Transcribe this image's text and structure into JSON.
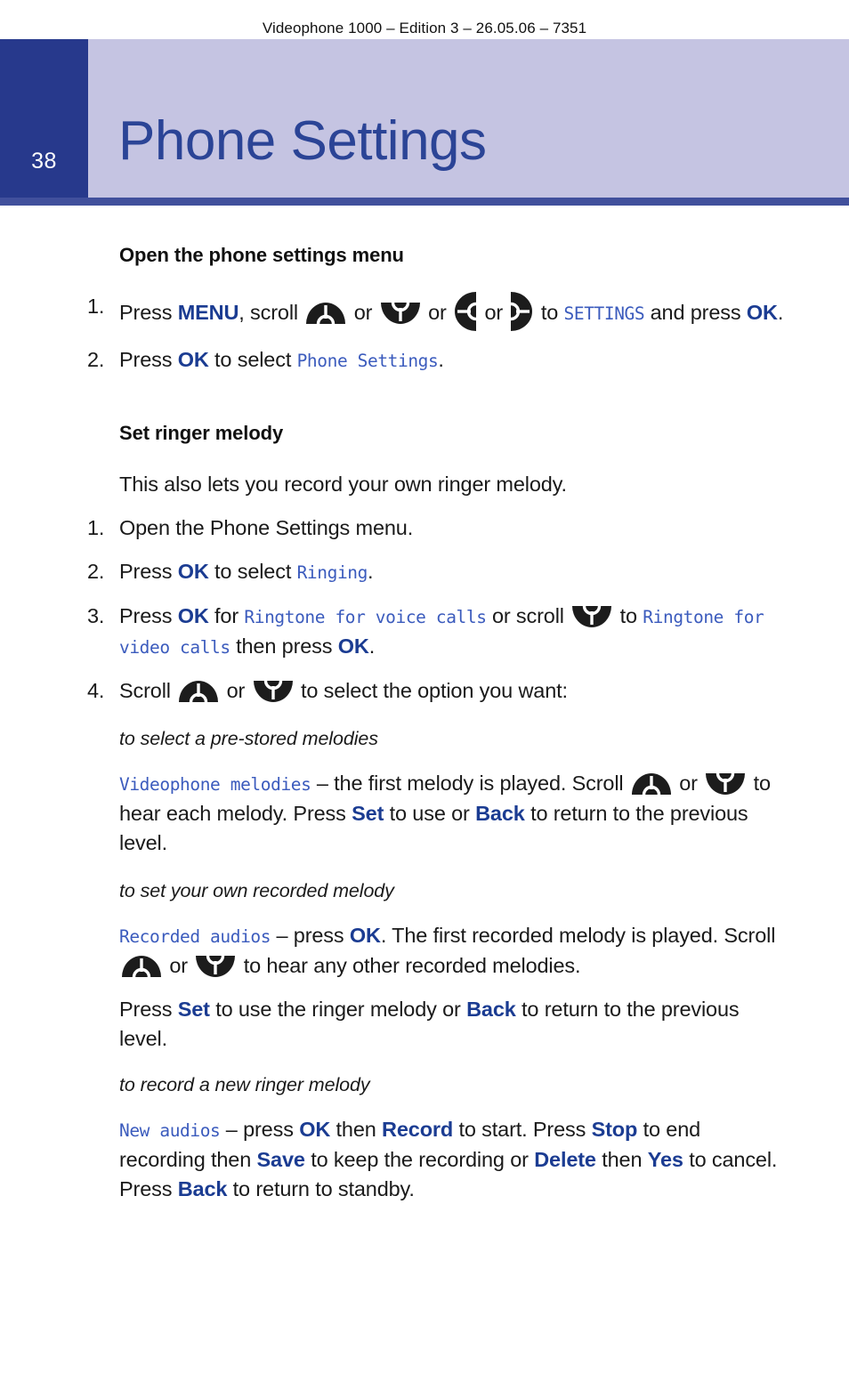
{
  "header": {
    "running_text": "Videophone 1000 – Edition 3 – 26.05.06 – 7351",
    "page_number": "38",
    "chapter_title": "Phone Settings",
    "band_color": "#c5c4e2",
    "page_block_color": "#27398c",
    "title_color": "#2b4496",
    "underline_color": "#41509c"
  },
  "colors": {
    "keyword_blue": "#1b3c92",
    "lcd_blue": "#3b5bbd",
    "body_text": "#1a1a1a"
  },
  "icons": {
    "up": "scroll-up-key-icon",
    "down": "scroll-down-key-icon",
    "left": "scroll-left-key-icon",
    "right": "scroll-right-key-icon"
  },
  "sections": [
    {
      "id": "open-phone-settings",
      "heading": "Open the phone settings menu",
      "items": [
        {
          "number": "1.",
          "parts": [
            {
              "t": "text",
              "v": "Press "
            },
            {
              "t": "kw",
              "v": "MENU"
            },
            {
              "t": "text",
              "v": ", scroll "
            },
            {
              "t": "icon",
              "v": "up"
            },
            {
              "t": "text",
              "v": " or "
            },
            {
              "t": "icon",
              "v": "down"
            },
            {
              "t": "text",
              "v": " or "
            },
            {
              "t": "icon",
              "v": "left"
            },
            {
              "t": "text",
              "v": " or "
            },
            {
              "t": "icon",
              "v": "right"
            },
            {
              "t": "text",
              "v": " to "
            },
            {
              "t": "lcd",
              "v": "SETTINGS"
            },
            {
              "t": "text",
              "v": " and press "
            },
            {
              "t": "kw",
              "v": "OK"
            },
            {
              "t": "text",
              "v": "."
            }
          ]
        },
        {
          "number": "2.",
          "parts": [
            {
              "t": "text",
              "v": "Press "
            },
            {
              "t": "kw",
              "v": "OK"
            },
            {
              "t": "text",
              "v": " to select "
            },
            {
              "t": "lcd",
              "v": "Phone Settings"
            },
            {
              "t": "text",
              "v": "."
            }
          ]
        }
      ]
    },
    {
      "id": "set-ringer-melody",
      "heading": "Set ringer melody",
      "intro": "This also lets you record your own ringer melody.",
      "items": [
        {
          "number": "1.",
          "parts": [
            {
              "t": "text",
              "v": "Open the Phone Settings menu."
            }
          ]
        },
        {
          "number": "2.",
          "parts": [
            {
              "t": "text",
              "v": "Press "
            },
            {
              "t": "kw",
              "v": "OK"
            },
            {
              "t": "text",
              "v": " to select "
            },
            {
              "t": "lcd",
              "v": "Ringing"
            },
            {
              "t": "text",
              "v": "."
            }
          ]
        },
        {
          "number": "3.",
          "parts": [
            {
              "t": "text",
              "v": "Press "
            },
            {
              "t": "kw",
              "v": "OK"
            },
            {
              "t": "text",
              "v": " for "
            },
            {
              "t": "lcd",
              "v": "Ringtone for voice calls"
            },
            {
              "t": "text",
              "v": " or scroll "
            },
            {
              "t": "icon",
              "v": "down"
            },
            {
              "t": "text",
              "v": " to "
            },
            {
              "t": "lcd",
              "v": "Ringtone for video calls"
            },
            {
              "t": "text",
              "v": " then press "
            },
            {
              "t": "kw",
              "v": "OK"
            },
            {
              "t": "text",
              "v": "."
            }
          ]
        },
        {
          "number": "4.",
          "parts": [
            {
              "t": "text",
              "v": "Scroll "
            },
            {
              "t": "icon",
              "v": "up"
            },
            {
              "t": "text",
              "v": " or "
            },
            {
              "t": "icon",
              "v": "down"
            },
            {
              "t": "text",
              "v": " to select the option you want:"
            }
          ]
        }
      ],
      "options": [
        {
          "lead": "to select a pre-stored  melodies",
          "parts": [
            {
              "t": "lcd",
              "v": "Videophone melodies"
            },
            {
              "t": "text",
              "v": " – the first melody is played. Scroll "
            },
            {
              "t": "icon",
              "v": "up"
            },
            {
              "t": "text",
              "v": " or "
            },
            {
              "t": "icon",
              "v": "down"
            },
            {
              "t": "text",
              "v": " to hear each melody. Press "
            },
            {
              "t": "kw",
              "v": "Set"
            },
            {
              "t": "text",
              "v": " to use or "
            },
            {
              "t": "kw",
              "v": "Back"
            },
            {
              "t": "text",
              "v": " to return to the previous level."
            }
          ]
        },
        {
          "lead": "to set your own recorded melody",
          "parts": [
            {
              "t": "lcd",
              "v": "Recorded audios"
            },
            {
              "t": "text",
              "v": " – press "
            },
            {
              "t": "kw",
              "v": "OK"
            },
            {
              "t": "text",
              "v": ". The first recorded melody is played. Scroll "
            },
            {
              "t": "icon",
              "v": "up"
            },
            {
              "t": "text",
              "v": " or "
            },
            {
              "t": "icon",
              "v": "down"
            },
            {
              "t": "text",
              "v": " to hear any other recorded melodies."
            }
          ],
          "extra_parts": [
            {
              "t": "text",
              "v": "Press "
            },
            {
              "t": "kw",
              "v": "Set"
            },
            {
              "t": "text",
              "v": " to use the ringer melody or "
            },
            {
              "t": "kw",
              "v": "Back"
            },
            {
              "t": "text",
              "v": " to return to the previous level."
            }
          ]
        },
        {
          "lead": "to record a new ringer melody",
          "parts": [
            {
              "t": "lcd",
              "v": "New audios"
            },
            {
              "t": "text",
              "v": " – press "
            },
            {
              "t": "kw",
              "v": "OK"
            },
            {
              "t": "text",
              "v": " then "
            },
            {
              "t": "kw",
              "v": "Record"
            },
            {
              "t": "text",
              "v": " to start. Press "
            },
            {
              "t": "kw",
              "v": "Stop"
            },
            {
              "t": "text",
              "v": " to end recording then "
            },
            {
              "t": "kw",
              "v": "Save"
            },
            {
              "t": "text",
              "v": " to keep the recording or "
            },
            {
              "t": "kw",
              "v": "Delete"
            },
            {
              "t": "text",
              "v": " then "
            },
            {
              "t": "kw",
              "v": "Yes"
            },
            {
              "t": "text",
              "v": " to cancel. Press "
            },
            {
              "t": "kw",
              "v": "Back"
            },
            {
              "t": "text",
              "v": "  to return to standby."
            }
          ]
        }
      ]
    }
  ]
}
